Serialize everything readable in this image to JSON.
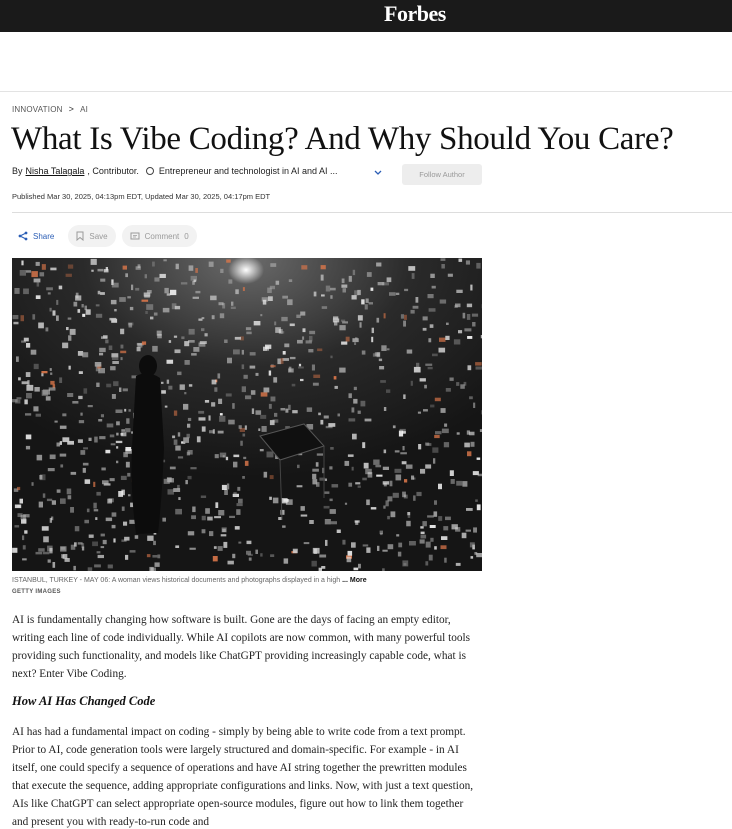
{
  "header": {
    "logo": "Forbes"
  },
  "breadcrumb": {
    "section": "INNOVATION",
    "separator": ">",
    "subsection": "AI"
  },
  "article": {
    "title": "What Is Vibe Coding? And Why Should You Care?",
    "byline": {
      "by": "By",
      "author": "Nisha Talagala",
      "role": ", Contributor.",
      "bio": "Entrepreneur and technologist in AI and AI ...",
      "follow_label": "Follow Author"
    },
    "published": "Published Mar 30, 2025, 04:13pm EDT, Updated Mar 30, 2025, 04:17pm EDT",
    "actions": {
      "share_label": "Share",
      "save_label": "Save",
      "comment_label": "Comment",
      "comment_count": "0"
    },
    "image": {
      "caption": "ISTANBUL, TURKEY - MAY 06: A woman views historical documents and photographs displayed in a high",
      "more_label": "... More",
      "credit": "GETTY IMAGES"
    },
    "paragraph_1": "AI is fundamentally changing how software is built. Gone are the days of facing an empty editor, writing each line of code individually. While AI copilots are now common, with many powerful tools providing such functionality, and models like ChatGPT providing increasingly capable code, what is next? Enter Vibe Coding.",
    "subheading": "How AI Has Changed Code",
    "paragraph_2": "AI has had a fundamental impact on coding - simply by being able to write code from a text prompt. Prior to AI, code generation tools were largely structured and domain-specific. For example - in AI itself, one could specify a sequence of operations and have AI string together the prewritten modules that execute the sequence, adding appropriate configurations and links. Now, with just a text question, AIs like ChatGPT can select appropriate open-source modules, figure out how to link them together and present you with ready-to-run code and"
  },
  "colors": {
    "topbar": "#1a1a1a",
    "link_blue": "#2b5eb5",
    "button_grey": "#ededed"
  }
}
